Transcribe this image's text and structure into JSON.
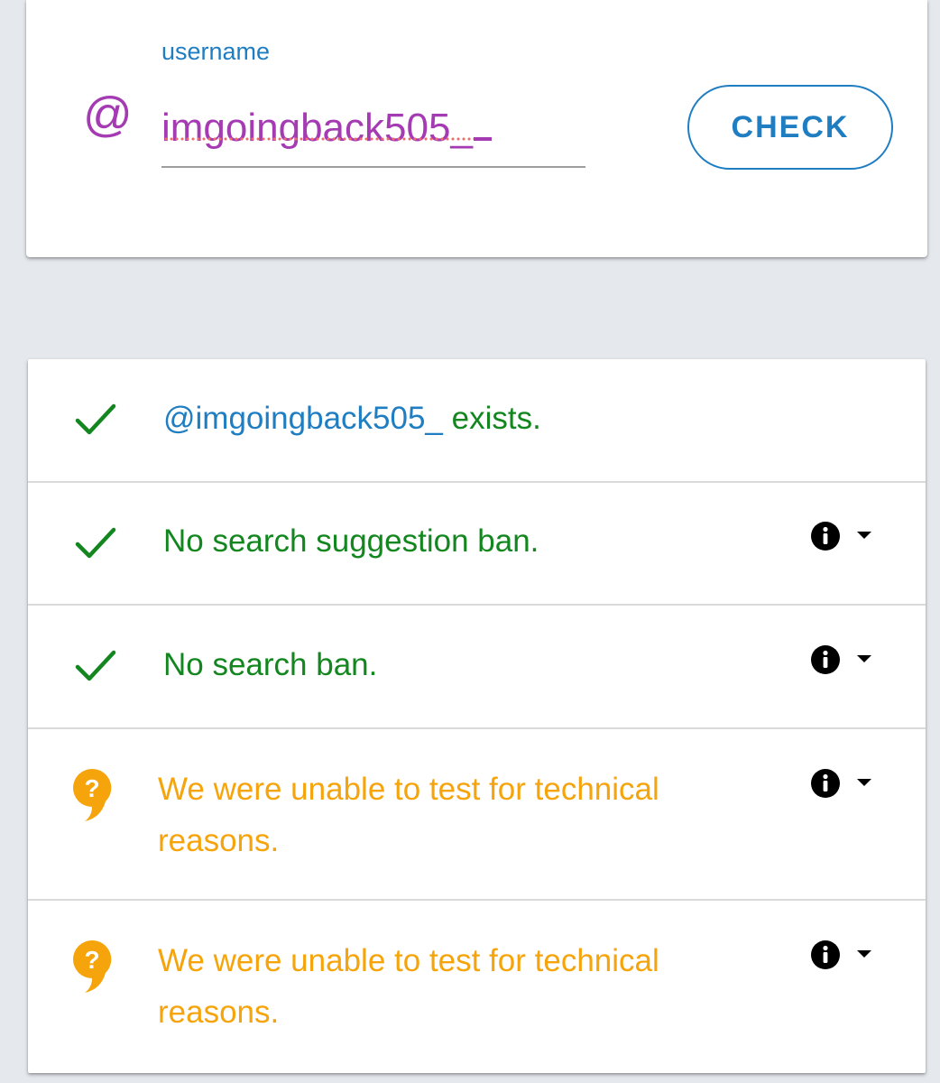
{
  "search": {
    "label": "username",
    "at_symbol": "@",
    "value": "imgoingback505_",
    "button_label": "CHECK"
  },
  "colors": {
    "background": "#e5e9ed",
    "accent_blue": "#1f7dc2",
    "input_purple": "#a43bb3",
    "ok_green": "#13861f",
    "unknown_orange": "#f6a40b"
  },
  "results": [
    {
      "status": "ok",
      "icon": "check-icon",
      "handle": "@imgoingback505_",
      "text": " exists.",
      "has_details": false
    },
    {
      "status": "ok",
      "icon": "check-icon",
      "text": "No search suggestion ban.",
      "has_details": true
    },
    {
      "status": "ok",
      "icon": "check-icon",
      "text": "No search ban.",
      "has_details": true
    },
    {
      "status": "unknown",
      "icon": "question-bubble-icon",
      "text": "We were unable to test for technical reasons.",
      "has_details": true
    },
    {
      "status": "unknown",
      "icon": "question-bubble-icon",
      "text": "We were unable to test for technical reasons.",
      "has_details": true
    }
  ]
}
